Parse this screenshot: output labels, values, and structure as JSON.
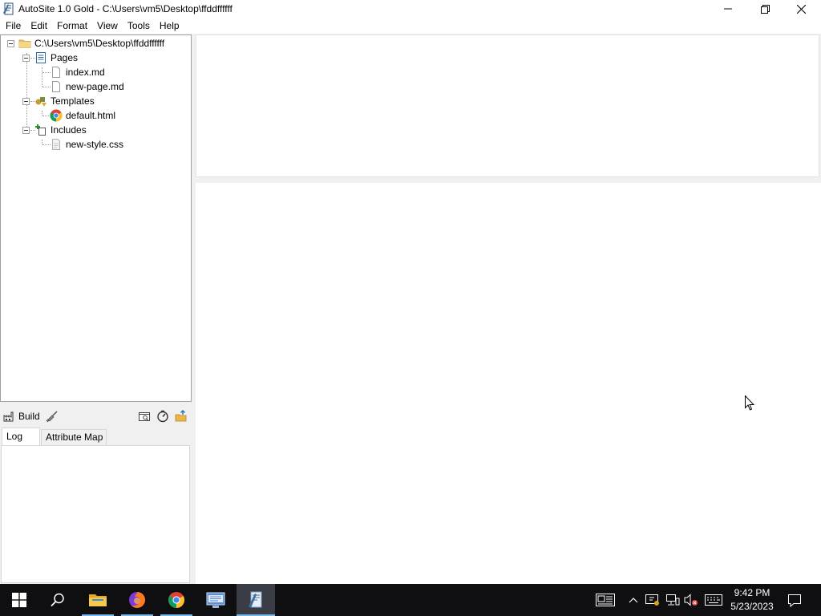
{
  "window": {
    "title": "AutoSite 1.0 Gold - C:\\Users\\vm5\\Desktop\\ffddffffff"
  },
  "menu": [
    "File",
    "Edit",
    "Format",
    "View",
    "Tools",
    "Help"
  ],
  "tree": {
    "root": "C:\\Users\\vm5\\Desktop\\ffddffffff",
    "pages_label": "Pages",
    "pages": [
      "index.md",
      "new-page.md"
    ],
    "templates_label": "Templates",
    "templates": [
      "default.html"
    ],
    "includes_label": "Includes",
    "includes": [
      "new-style.css"
    ]
  },
  "build": {
    "build_label": "Build"
  },
  "tabs": {
    "log": "Log",
    "attribute_map": "Attribute Map"
  },
  "taskbar": {
    "time": "9:42 PM",
    "date": "5/23/2023"
  },
  "colors": {
    "taskbar_bg": "#0f0f12",
    "taskbar_accent": "#76b9ed",
    "panel_border": "#a0a0a0"
  }
}
